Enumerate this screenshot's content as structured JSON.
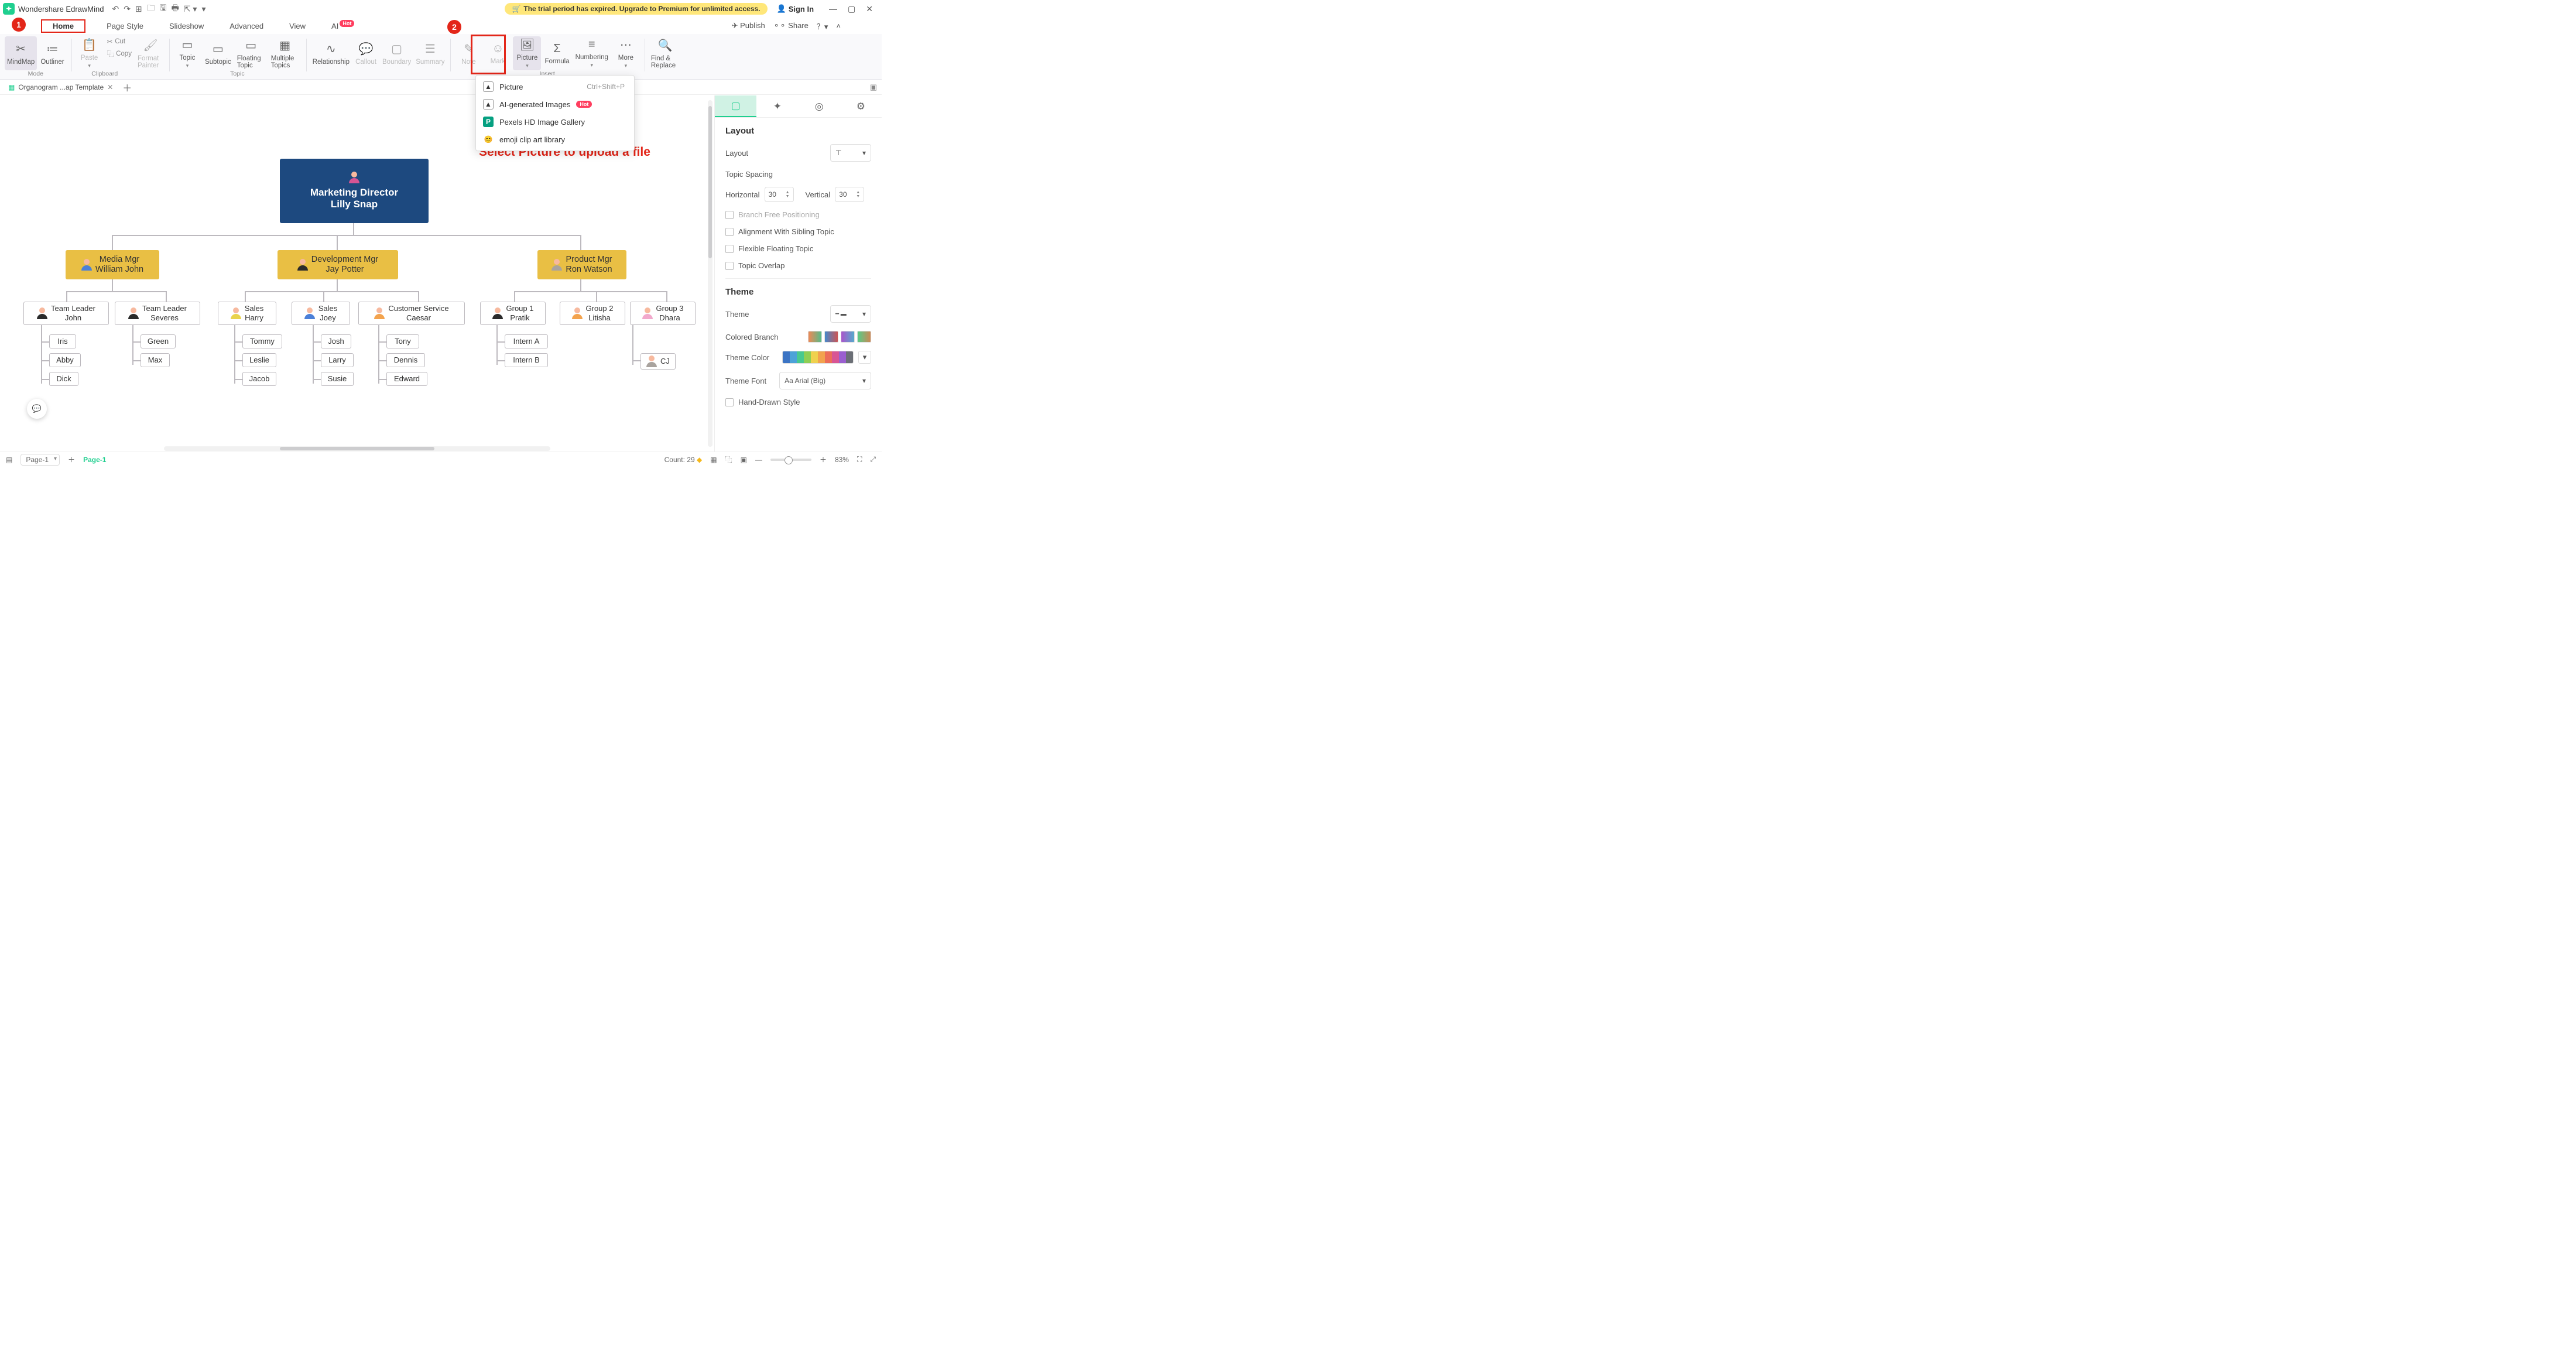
{
  "app": {
    "name": "Wondershare EdrawMind"
  },
  "trial_banner": "The trial period has expired. Upgrade to Premium for unlimited access.",
  "signin": "Sign In",
  "menu": {
    "home": "Home",
    "page_style": "Page Style",
    "slideshow": "Slideshow",
    "advanced": "Advanced",
    "view": "View",
    "ai": "AI",
    "hot": "Hot",
    "publish": "Publish",
    "share": "Share"
  },
  "ribbon": {
    "mindmap": "MindMap",
    "outliner": "Outliner",
    "mode": "Mode",
    "paste": "Paste",
    "cut": "Cut",
    "copy": "Copy",
    "clipboard": "Clipboard",
    "format_painter": "Format Painter",
    "topic": "Topic",
    "subtopic": "Subtopic",
    "floating": "Floating Topic",
    "multiple": "Multiple Topics",
    "topic_group": "Topic",
    "relationship": "Relationship",
    "callout": "Callout",
    "boundary": "Boundary",
    "summary": "Summary",
    "note": "Note",
    "mark": "Mark",
    "picture": "Picture",
    "formula": "Formula",
    "numbering": "Numbering",
    "more": "More",
    "insert": "Insert",
    "find_replace": "Find & Replace"
  },
  "dropdown": {
    "picture": "Picture",
    "shortcut": "Ctrl+Shift+P",
    "ai_images": "AI-generated Images",
    "hot": "Hot",
    "pexels": "Pexels HD Image Gallery",
    "emoji": "emoji clip art library"
  },
  "annotation": "Select Picture to upload a file",
  "doc_tab": "Organogram ...ap Template",
  "chart": {
    "root": {
      "title": "Marketing Director",
      "name": "Lilly Snap"
    },
    "mgr_media": {
      "title": "Media Mgr",
      "name": "William John"
    },
    "mgr_dev": {
      "title": "Development Mgr",
      "name": "Jay Potter"
    },
    "mgr_prod": {
      "title": "Product Mgr",
      "name": "Ron Watson"
    },
    "tl_john": {
      "title": "Team Leader",
      "name": "John"
    },
    "tl_severes": {
      "title": "Team Leader",
      "name": "Severes"
    },
    "sales_harry": {
      "title": "Sales",
      "name": "Harry"
    },
    "sales_joey": {
      "title": "Sales",
      "name": "Joey"
    },
    "cs_caesar": {
      "title": "Customer Service",
      "name": "Caesar"
    },
    "g1": {
      "title": "Group 1",
      "name": "Pratik"
    },
    "g2": {
      "title": "Group 2",
      "name": "Litisha"
    },
    "g3": {
      "title": "Group 3",
      "name": "Dhara"
    },
    "iris": "Iris",
    "abby": "Abby",
    "dick": "Dick",
    "green": "Green",
    "max": "Max",
    "tommy": "Tommy",
    "leslie": "Leslie",
    "jacob": "Jacob",
    "josh": "Josh",
    "larry": "Larry",
    "susie": "Susie",
    "tony": "Tony",
    "dennis": "Dennis",
    "edward": "Edward",
    "intern_a": "Intern A",
    "intern_b": "Intern B",
    "cj": "CJ"
  },
  "panel": {
    "layout": "Layout",
    "layout_label": "Layout",
    "spacing": "Topic Spacing",
    "horizontal": "Horizontal",
    "h_val": "30",
    "vertical": "Vertical",
    "v_val": "30",
    "branch_free": "Branch Free Positioning",
    "align_sibling": "Alignment With Sibling Topic",
    "flex_float": "Flexible Floating Topic",
    "overlap": "Topic Overlap",
    "theme": "Theme",
    "theme_label": "Theme",
    "colored_branch": "Colored Branch",
    "theme_color": "Theme Color",
    "theme_font": "Theme Font",
    "font_name": "Arial (Big)",
    "hand_drawn": "Hand-Drawn Style"
  },
  "status": {
    "page_sel": "Page-1",
    "page_link": "Page-1",
    "count": "Count: 29",
    "zoom": "83%"
  },
  "markers": {
    "m1": "1",
    "m2": "2"
  }
}
